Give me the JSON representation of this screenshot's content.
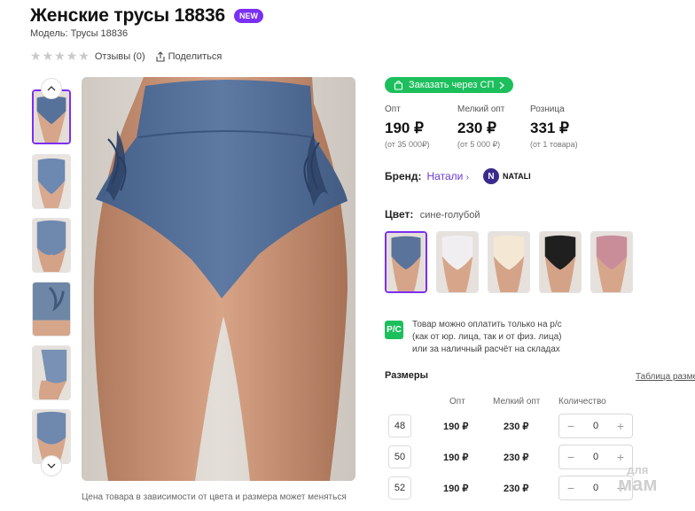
{
  "product": {
    "title": "Женские трусы 18836",
    "badge": "NEW",
    "model": "Модель: Трусы 18836",
    "reviews": "Отзывы (0)",
    "share": "Поделиться"
  },
  "gallery": {
    "note": "Цена товара в зависимости от цвета и размера может меняться",
    "thumb_colors": [
      "#56719a",
      "#6d88b1",
      "#6f89ae",
      "#6e87a6",
      "#7891b4",
      "#6f88ad"
    ]
  },
  "order": {
    "sp_button": "Заказать через СП"
  },
  "prices": [
    {
      "label": "Опт",
      "value": "190 ₽",
      "min": "(от 35 000₽)"
    },
    {
      "label": "Мелкий опт",
      "value": "230 ₽",
      "min": "(от 5 000 ₽)"
    },
    {
      "label": "Розница",
      "value": "331 ₽",
      "min": "(от 1 товара)"
    }
  ],
  "brand": {
    "label": "Бренд:",
    "name": "Натали",
    "logo_letter": "N",
    "logo_text": "NATALI"
  },
  "color": {
    "label": "Цвет:",
    "value": "сине-голубой",
    "swatches": [
      "#5a739a",
      "#f1eef2",
      "#f4e8d4",
      "#1f1f1f",
      "#c98d9a"
    ]
  },
  "payment": {
    "icon": "Р/С",
    "text_lines": [
      "Товар можно оплатить только на р/с",
      "(как от юр. лица, так и от физ. лица)",
      "или за наличный расчёт на складах"
    ]
  },
  "sizes": {
    "title": "Размеры",
    "table_link": "Таблица размеров",
    "headers": {
      "opt": "Опт",
      "small": "Мелкий опт",
      "qty": "Количество"
    },
    "rows": [
      {
        "size": "48",
        "opt": "190 ₽",
        "small": "230 ₽",
        "qty": "0"
      },
      {
        "size": "50",
        "opt": "190 ₽",
        "small": "230 ₽",
        "qty": "0"
      },
      {
        "size": "52",
        "opt": "190 ₽",
        "small": "230 ₽",
        "qty": "0"
      }
    ]
  },
  "watermark": {
    "line1": "для",
    "line2": "мам"
  },
  "colors": {
    "accent": "#7b2ff2",
    "green": "#1cbf5c",
    "link": "#6a3ad7"
  }
}
